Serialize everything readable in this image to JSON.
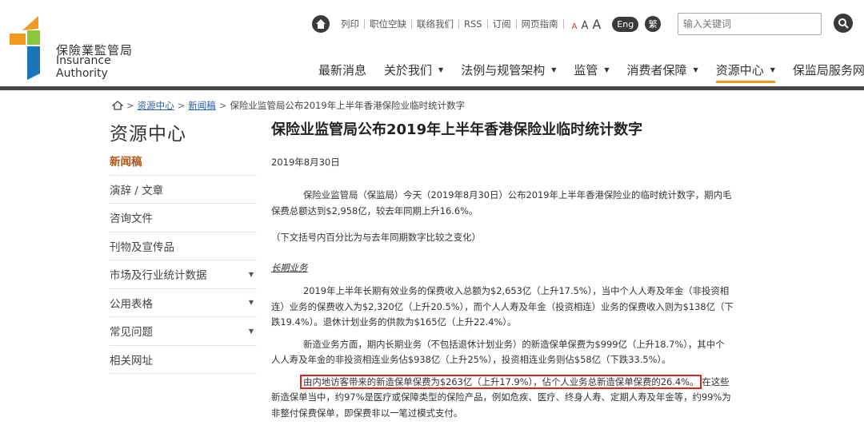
{
  "logo": {
    "name_cn": "保險業監管局",
    "name_en": "Insurance Authority"
  },
  "utility_links": [
    "列印",
    "职位空缺",
    "联络我们",
    "RSS",
    "订阅",
    "网页指南"
  ],
  "font_size_labels": [
    "A",
    "A",
    "A"
  ],
  "lang": {
    "eng": "Eng",
    "trad": "繁"
  },
  "search": {
    "placeholder": "输入关键词"
  },
  "nav": [
    {
      "label": "最新消息",
      "dropdown": false
    },
    {
      "label": "关於我们",
      "dropdown": true
    },
    {
      "label": "法例与规管架构",
      "dropdown": true
    },
    {
      "label": "监管",
      "dropdown": true
    },
    {
      "label": "消费者保障",
      "dropdown": true
    },
    {
      "label": "资源中心",
      "dropdown": true,
      "active": true
    },
    {
      "label": "保监局服务网站",
      "dropdown": true
    }
  ],
  "breadcrumb": {
    "items": [
      "资源中心",
      "新闻稿"
    ],
    "current": "保险业监管局公布2019年上半年香港保险业临时统计数字"
  },
  "sidebar": {
    "title": "资源中心",
    "items": [
      {
        "label": "新闻稿",
        "dropdown": false,
        "current": true
      },
      {
        "label": "演辞 / 文章",
        "dropdown": false
      },
      {
        "label": "咨询文件",
        "dropdown": false
      },
      {
        "label": "刊物及宣传品",
        "dropdown": false
      },
      {
        "label": "市场及行业统计数据",
        "dropdown": true
      },
      {
        "label": "公用表格",
        "dropdown": true
      },
      {
        "label": "常见问题",
        "dropdown": true
      },
      {
        "label": "相关网址",
        "dropdown": false
      }
    ]
  },
  "article": {
    "title": "保险业监管局公布2019年上半年香港保险业临时统计数字",
    "date": "2019年8月30日",
    "p1_line1": "保险业监管局（保监局）今天（2019年8月30日）公布2019年上半年香港保险业的临时统计数字，期内毛",
    "p1_line2": "保费总额达到$2,958亿，较去年同期上升16.6%。",
    "p2": "（下文括号内百分比为与去年同期数字比较之变化）",
    "section_head": "长期业务",
    "p3_line1": "2019年上半年长期有效业务的保费收入总额为$2,653亿（上升17.5%），当中个人人寿及年金（非投资相",
    "p3_line2": "连）业务的保费收入为$2,320亿（上升20.5%），而个人人寿及年金（投资相连）业务的保费收入则为$138亿（下",
    "p3_line3": "跌19.4%）。退休计划业务的供款为$165亿（上升22.4%）。",
    "p4_line1": "新造业务方面，期内长期业务（不包括退休计划业务）的新造保单保费为$999亿（上升18.7%），其中个",
    "p4_line2": "人人寿及年金的非投资相连业务佔$938亿（上升25%），投资相连业务则佔$58亿（下跌33.5%）。",
    "p5_highlight": "由内地访客带来的新造保单保费为$263亿（上升17.9%），佔个人业务总新造保单保费的26.4%。",
    "p5_tail": "在这些",
    "p5_line2": "新造保单当中，约97%是医疗或保障类型的保险产品，例如危疾、医疗、终身人寿、定期人寿及年金等，约99%为",
    "p5_line3": "非整付保费保单，即保费非以一笔过模式支付。"
  },
  "colors": {
    "nav_active": "#f29a1f",
    "header_rule": "#4a4a4a",
    "highlight_box": "#e0241b",
    "sidebar_current": "#b4541c"
  }
}
